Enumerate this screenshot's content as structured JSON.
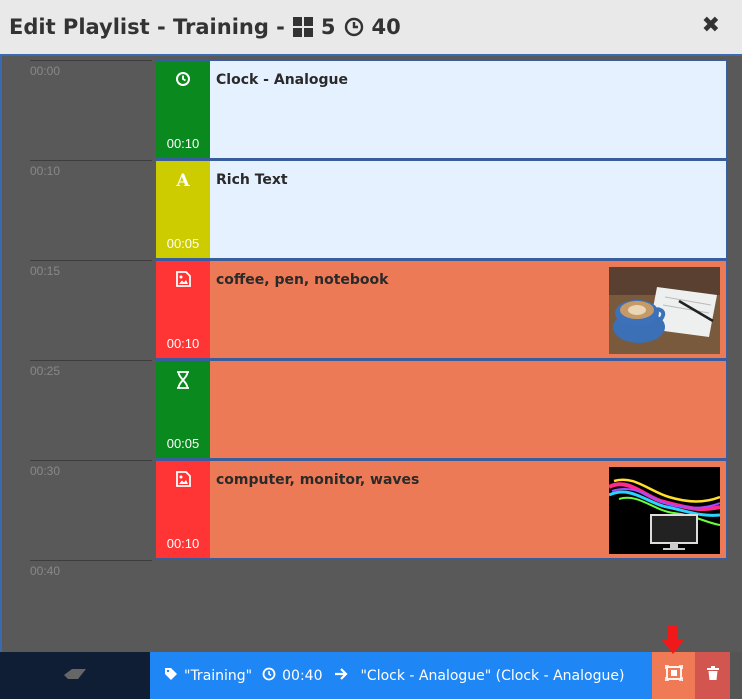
{
  "header": {
    "title_prefix": "Edit Playlist - Training -",
    "widget_count": "5",
    "duration": "40",
    "close_glyph": "✖"
  },
  "timeline": {
    "ticks": [
      "00:00",
      "00:10",
      "00:15",
      "00:25",
      "00:30",
      "00:40"
    ]
  },
  "items": [
    {
      "name": "Clock - Analogue",
      "duration": "00:10",
      "icon": "clock-icon",
      "color": "#0a8a1e",
      "bg": "#e5f1ff"
    },
    {
      "name": "Rich Text",
      "duration": "00:05",
      "icon": "font-icon",
      "color": "#cdcc00",
      "bg": "#e5f1ff"
    },
    {
      "name": "coffee, pen, notebook",
      "duration": "00:10",
      "icon": "image-icon",
      "color": "#ff3434",
      "bg": "#ec7a56"
    },
    {
      "name": "",
      "duration": "00:05",
      "icon": "hourglass-icon",
      "color": "#0a8a1e",
      "bg": "#ec7a56"
    },
    {
      "name": "computer, monitor, waves",
      "duration": "00:10",
      "icon": "image-icon",
      "color": "#ff3434",
      "bg": "#ec7a56"
    }
  ],
  "footer": {
    "tag": "\"Training\"",
    "duration": "00:40",
    "target": "\"Clock - Analogue\" (Clock - Analogue)",
    "info_bg": "#1f86f5",
    "fit_bg": "#f07a56",
    "delete_bg": "#d2564f"
  }
}
